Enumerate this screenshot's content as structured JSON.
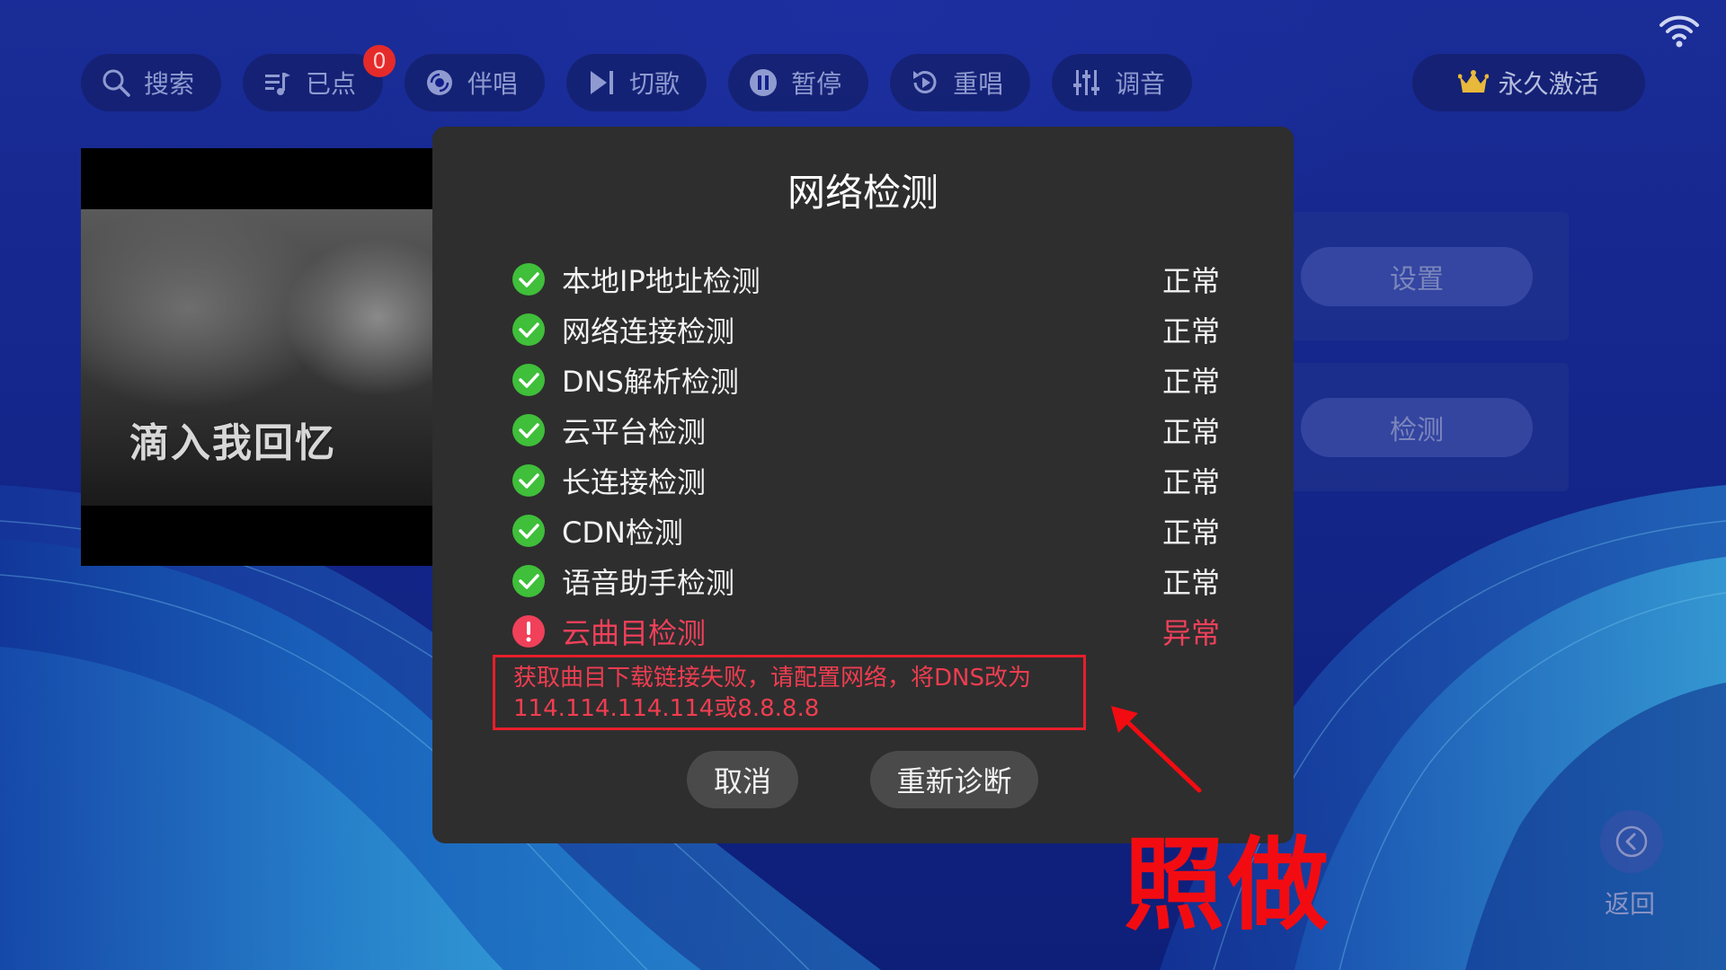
{
  "toolbar": {
    "items": [
      {
        "label": "搜索",
        "icon": "search-icon"
      },
      {
        "label": "已点",
        "icon": "playlist-icon",
        "badge": "0"
      },
      {
        "label": "伴唱",
        "icon": "accompany-icon"
      },
      {
        "label": "切歌",
        "icon": "next-song-icon"
      },
      {
        "label": "暂停",
        "icon": "pause-icon"
      },
      {
        "label": "重唱",
        "icon": "replay-icon"
      },
      {
        "label": "调音",
        "icon": "mixer-icon"
      }
    ],
    "activate_label": "永久激活"
  },
  "video": {
    "lyric": "滴入我回忆"
  },
  "side_panel": {
    "settings_label": "设置",
    "detect_label": "检测"
  },
  "dialog": {
    "title": "网络检测",
    "checks": [
      {
        "name": "本地IP地址检测",
        "status": "正常",
        "state": "ok"
      },
      {
        "name": "网络连接检测",
        "status": "正常",
        "state": "ok"
      },
      {
        "name": "DNS解析检测",
        "status": "正常",
        "state": "ok"
      },
      {
        "name": "云平台检测",
        "status": "正常",
        "state": "ok"
      },
      {
        "name": "长连接检测",
        "status": "正常",
        "state": "ok"
      },
      {
        "name": "CDN检测",
        "status": "正常",
        "state": "ok"
      },
      {
        "name": "语音助手检测",
        "status": "正常",
        "state": "ok"
      },
      {
        "name": "云曲目检测",
        "status": "异常",
        "state": "error"
      }
    ],
    "error_message_line1": "获取曲目下载链接失败，请配置网络，将DNS改为",
    "error_message_line2": "114.114.114.114或8.8.8.8",
    "cancel_label": "取消",
    "retry_label": "重新诊断"
  },
  "annotation": {
    "text": "照做"
  },
  "back_label": "返回",
  "colors": {
    "ok_green": "#3fbf3a",
    "error_red": "#f0405a",
    "annotation_red": "#f20c12",
    "dialog_bg": "#2e2e2e"
  }
}
